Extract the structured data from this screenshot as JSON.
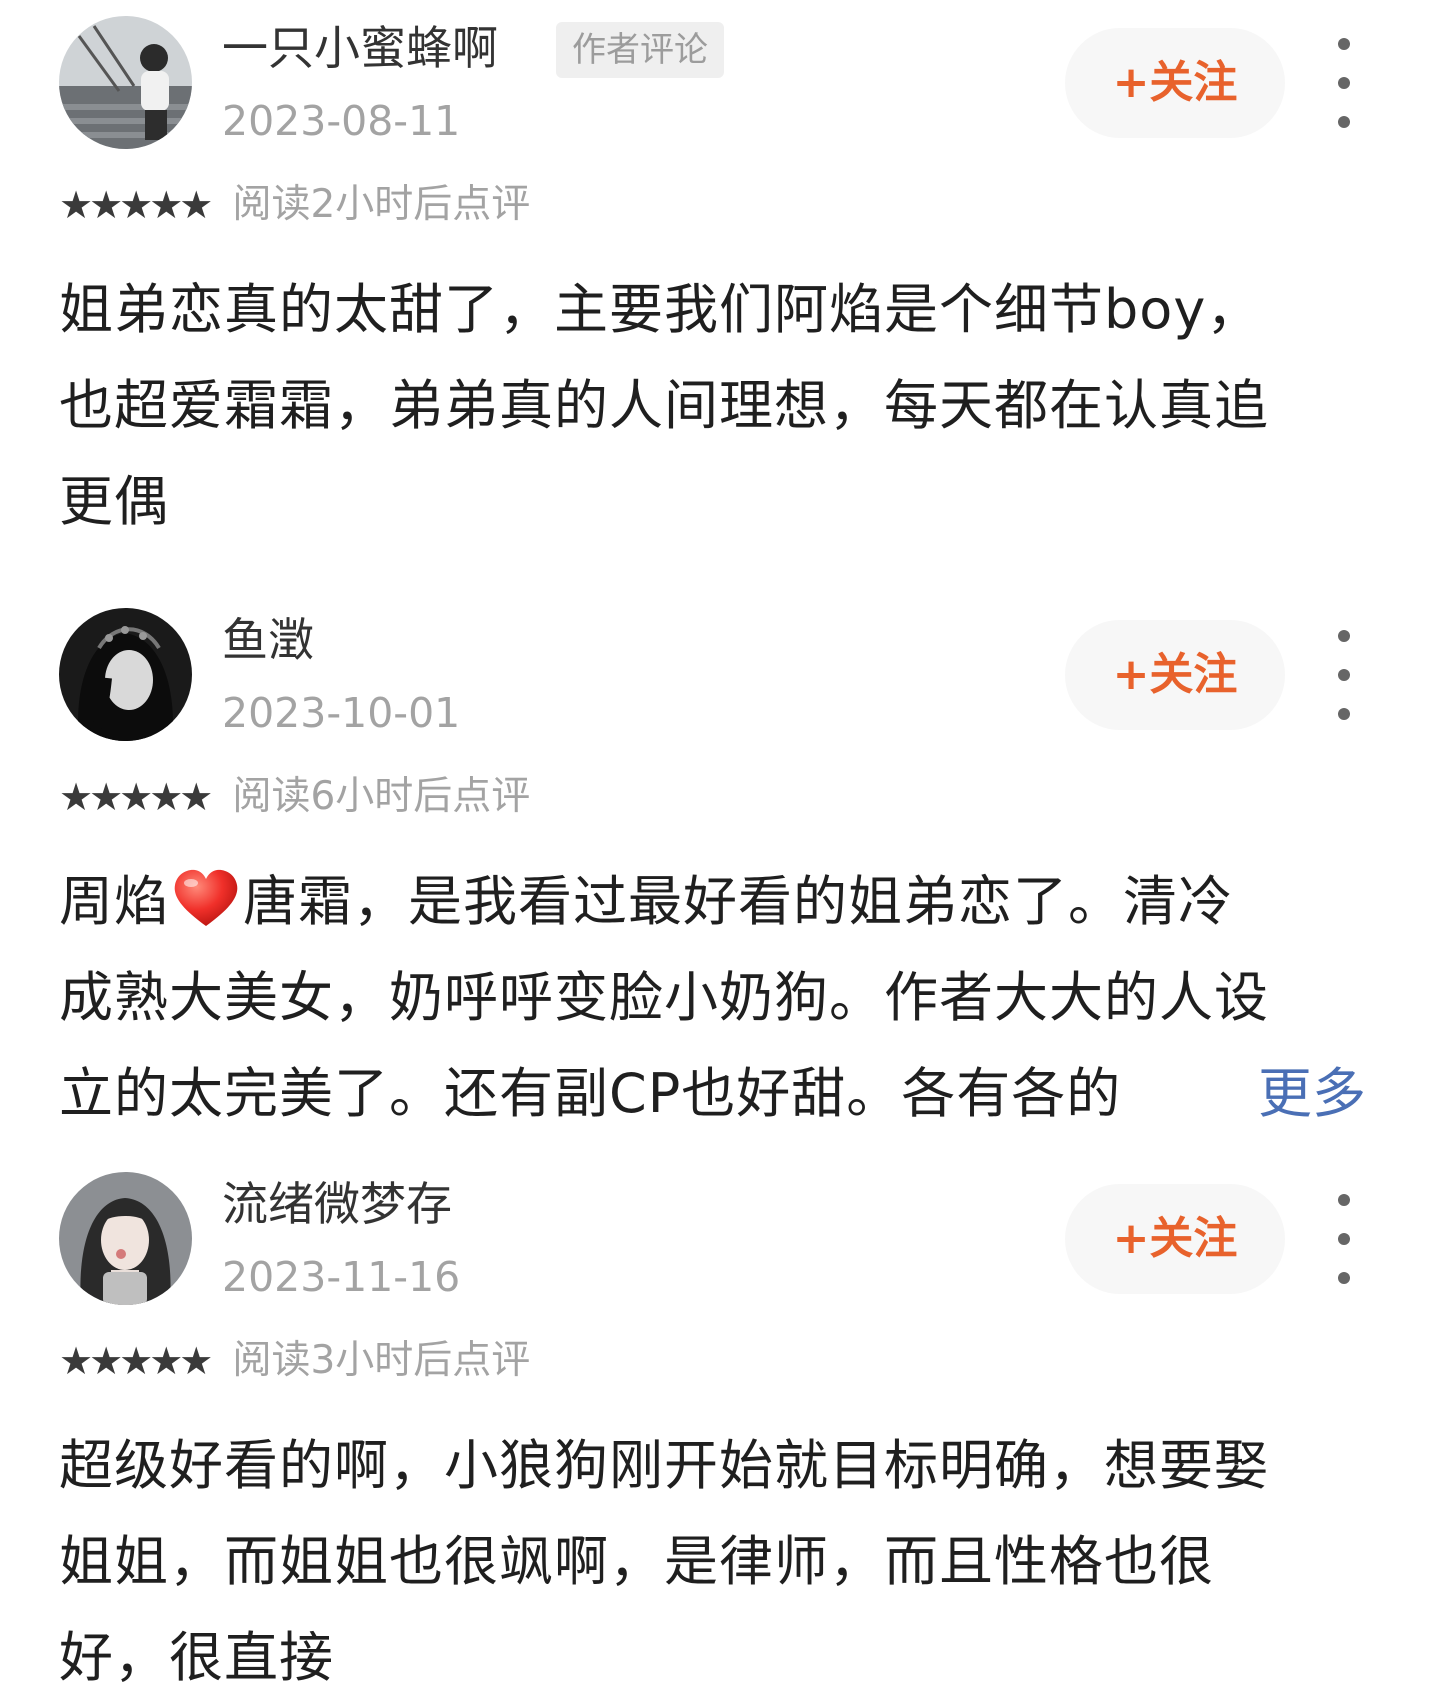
{
  "theme": {
    "follow_color": "#e8622c",
    "more_link_color": "#4a6fb5",
    "meta_color": "#a3a3a3"
  },
  "reviews": [
    {
      "username": "一只小蜜蜂啊",
      "author_tag": "作者评论",
      "date": "2023-08-11",
      "follow_label": "+关注",
      "stars": "★★★★★",
      "rating": 5,
      "read_note": "阅读2小时后点评",
      "lines": [
        "姐弟恋真的太甜了，主要我们阿焰是个细节boy，",
        "也超爱霜霜，弟弟真的人间理想，每天都在认真追",
        "更偶"
      ]
    },
    {
      "username": "鱼澂",
      "date": "2023-10-01",
      "follow_label": "+关注",
      "stars": "★★★★★",
      "rating": 5,
      "read_note": "阅读6小时后点评",
      "line1_a": "周焰",
      "line1_b": "唐霜，是我看过最好看的姐弟恋了。清冷",
      "line2": "成熟大美女，奶呼呼变脸小奶狗。作者大大的人设",
      "line3": "立的太完美了。还有副CP也好甜。各有各的",
      "more_label": "更多"
    },
    {
      "username": "流绪微梦存",
      "date": "2023-11-16",
      "follow_label": "+关注",
      "stars": "★★★★★",
      "rating": 5,
      "read_note": "阅读3小时后点评",
      "lines": [
        "超级好看的啊，小狼狗刚开始就目标明确，想要娶",
        "姐姐，而姐姐也很飒啊，是律师，而且性格也很",
        "好，很直接"
      ]
    }
  ]
}
